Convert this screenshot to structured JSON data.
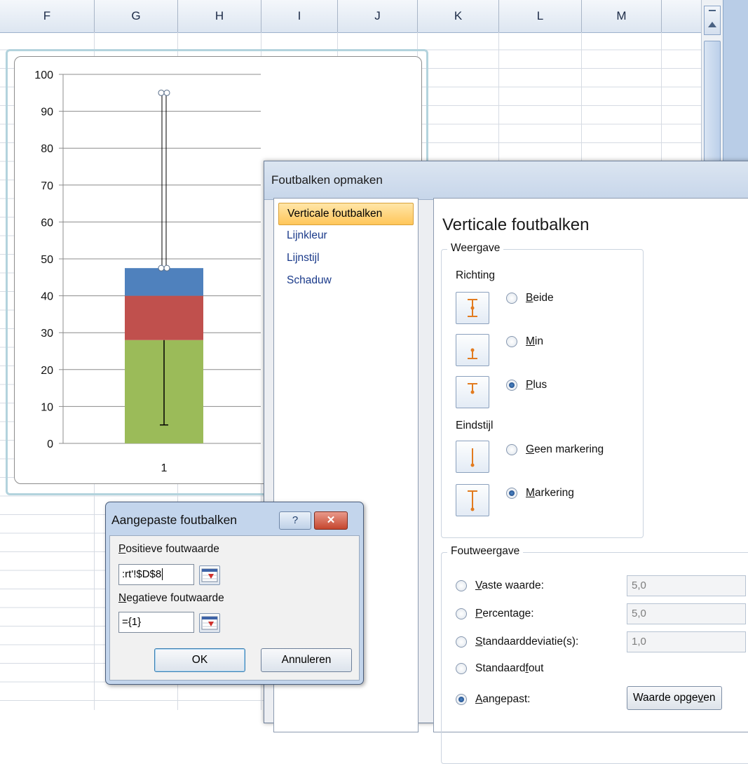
{
  "sheet": {
    "columns": [
      "F",
      "G",
      "H",
      "I",
      "J",
      "K",
      "L",
      "M"
    ]
  },
  "chart_data": {
    "type": "bar",
    "stacked": true,
    "categories": [
      "1"
    ],
    "series": [
      {
        "color": "#9bbb59",
        "values": [
          28
        ]
      },
      {
        "color": "#c0504d",
        "values": [
          12
        ]
      },
      {
        "color": "#4f81bd",
        "values": [
          7.5
        ]
      }
    ],
    "error_bars": [
      {
        "series_index": 0,
        "direction": "minus",
        "low": 5,
        "high": 28
      },
      {
        "series_index": 2,
        "direction": "plus",
        "low": 47.5,
        "high": 95
      }
    ],
    "ylim": [
      0,
      100
    ],
    "yticks": [
      "0",
      "10",
      "20",
      "30",
      "40",
      "50",
      "60",
      "70",
      "80",
      "90",
      "100"
    ],
    "grid": true
  },
  "format_dialog": {
    "title": "Foutbalken opmaken",
    "nav": [
      "Verticale foutbalken",
      "Lijnkleur",
      "Lijnstijl",
      "Schaduw"
    ],
    "heading": "Verticale foutbalken",
    "display_group": "Weergave",
    "direction_label": "Richting",
    "direction_options": [
      {
        "key": "B",
        "rest": "eide",
        "checked": false,
        "icon": "both-errorbar-icon"
      },
      {
        "key": "M",
        "rest": "in",
        "checked": false,
        "icon": "minus-errorbar-icon"
      },
      {
        "key": "P",
        "rest": "lus",
        "checked": true,
        "icon": "plus-errorbar-icon"
      }
    ],
    "endstyle_label": "Eindstijl",
    "endstyle_options": [
      {
        "key": "G",
        "rest": "een markering",
        "checked": false,
        "icon": "no-cap-icon"
      },
      {
        "key": "M",
        "rest": "arkering",
        "checked": true,
        "icon": "cap-icon"
      }
    ],
    "amount_group": "Foutweergave",
    "amount_options": [
      {
        "pre": "",
        "key": "V",
        "rest": "aste waarde:",
        "checked": false,
        "value": "5,0"
      },
      {
        "pre": "",
        "key": "P",
        "rest": "ercentage:",
        "checked": false,
        "value": "5,0"
      },
      {
        "pre": "",
        "key": "S",
        "rest": "tandaarddeviatie(s):",
        "checked": false,
        "value": "1,0"
      },
      {
        "pre": "Standaard",
        "key": "f",
        "rest": "out",
        "checked": false,
        "value": null
      },
      {
        "pre": "",
        "key": "A",
        "rest": "angepast:",
        "checked": true,
        "value": null
      }
    ],
    "specify_value_pre": "Waarde opge",
    "specify_value_key": "v",
    "specify_value_post": "en"
  },
  "custom_dialog": {
    "title": "Aangepaste foutbalken",
    "help": "?",
    "close": "✕",
    "positive_key": "P",
    "positive_rest": "ositieve foutwaarde",
    "positive_value": ":rt'!$D$8",
    "negative_key": "N",
    "negative_rest": "egatieve foutwaarde",
    "negative_value": "={1}",
    "ok": "OK",
    "cancel": "Annuleren"
  }
}
